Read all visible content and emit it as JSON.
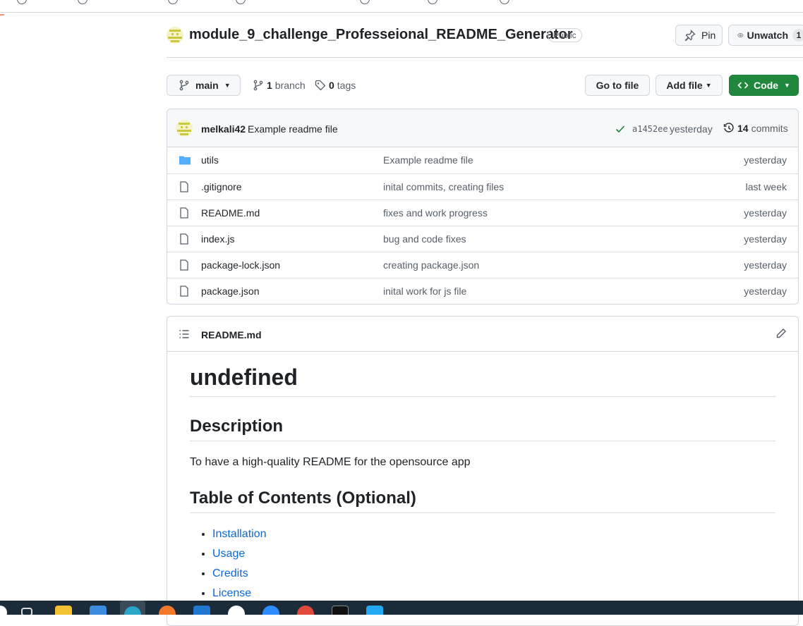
{
  "repo": {
    "name": "module_9_challenge_Professeional_README_Generator",
    "visibility": "Public",
    "pin_label": "Pin",
    "unwatch_label": "Unwatch",
    "watch_count": "1"
  },
  "branch_bar": {
    "branch_name": "main",
    "branch_count": "1",
    "branch_label": "branch",
    "tag_count": "0",
    "tag_label": "tags",
    "go_to_file": "Go to file",
    "add_file": "Add file",
    "code": "Code"
  },
  "commit": {
    "author": "melkali42",
    "message": "Example readme file",
    "sha": "a1452ee",
    "time": "yesterday",
    "commit_count": "14",
    "commit_label": "commits"
  },
  "files": [
    {
      "name": "utils",
      "type": "dir",
      "message": "Example readme file",
      "age": "yesterday"
    },
    {
      "name": ".gitignore",
      "type": "file",
      "message": "inital commits, creating files",
      "age": "last week"
    },
    {
      "name": "README.md",
      "type": "file",
      "message": "fixes and work progress",
      "age": "yesterday"
    },
    {
      "name": "index.js",
      "type": "file",
      "message": "bug and code fixes",
      "age": "yesterday"
    },
    {
      "name": "package-lock.json",
      "type": "file",
      "message": "creating package.json",
      "age": "yesterday"
    },
    {
      "name": "package.json",
      "type": "file",
      "message": "inital work for js file",
      "age": "yesterday"
    }
  ],
  "readme": {
    "filename": "README.md",
    "title": "undefined",
    "description_heading": "Description",
    "description_text": "To have a high-quality README for the opensource app",
    "toc_heading": "Table of Contents (Optional)",
    "toc_items": [
      "Installation",
      "Usage",
      "Credits",
      "License"
    ]
  },
  "colors": {
    "accent_green": "#1f883d",
    "link_blue": "#0969da",
    "folder_blue": "#54aeff",
    "check_green": "#1a7f37"
  },
  "icons": {
    "branch": "git-branch-icon",
    "tag": "tag-icon",
    "history": "history-icon",
    "check": "check-icon",
    "folder": "folder-icon",
    "file": "file-icon",
    "list": "list-icon",
    "pencil": "pencil-icon",
    "pin": "pin-icon",
    "eye": "eye-icon"
  }
}
